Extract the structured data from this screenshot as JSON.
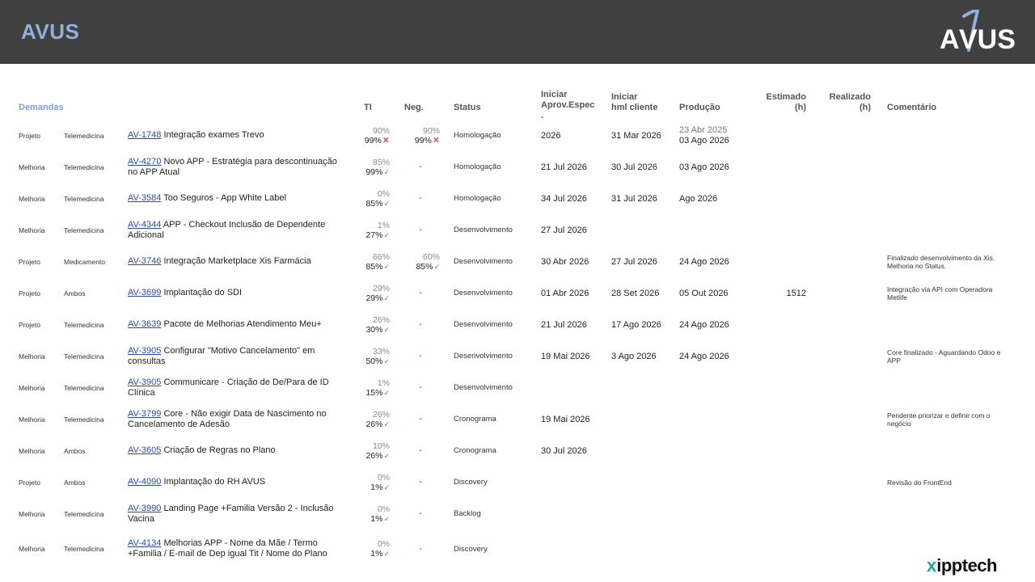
{
  "header": {
    "title": "AVUS",
    "logo_text": "AVUS"
  },
  "columns": {
    "demandas": "Demandas",
    "ti": "TI",
    "neg": "Neg.",
    "status": "Status",
    "aprov_1": "Iniciar",
    "aprov_2": "Aprov.Espec",
    "aprov_3": ".",
    "hml_1": "Iniciar",
    "hml_2": " hml cliente",
    "producao": "Produção",
    "estimado_1": "Estimado",
    "estimado_2": "(h)",
    "realizado_1": "Realizado",
    "realizado_2": "(h)",
    "comentario": "Comentário"
  },
  "rows": [
    {
      "tipo": "Projeto",
      "area": "Telemedicina",
      "code": "AV-1748",
      "title": " Integração exames Trevo",
      "ti_plan": "90%",
      "ti_real": "99%",
      "ti_mark": "✕",
      "neg_plan": "90%",
      "neg_real": "99%",
      "neg_mark": "✕",
      "status": "Homologação",
      "aprov": "2026",
      "hml": "31 Mar 2026",
      "prod_old": "23 Abr 2025",
      "prod": "03 Ago 2026",
      "estimado": "",
      "comentario": ""
    },
    {
      "tipo": "Melhoria",
      "area": "Telemedicina",
      "code": "AV-4270",
      "title": " Novo APP - Estratégia para descontinuação no APP Atual",
      "ti_plan": "85%",
      "ti_real": "99%",
      "ti_mark": "✓",
      "neg_dash": "-",
      "status": "Homologação",
      "aprov": "21 Jul  2026",
      "hml": "30 Jul 2026",
      "prod": "03 Ago 2026",
      "estimado": "",
      "comentario": ""
    },
    {
      "tipo": "Melhoria",
      "area": "Telemedicina",
      "code": "AV-3584",
      "title": " Too Seguros - App White Label",
      "ti_plan": "0%",
      "ti_real": "85%",
      "ti_mark": "✓",
      "neg_dash": "-",
      "status": "Homologação",
      "aprov": "34 Jul 2026",
      "hml": "31 Jul 2026",
      "prod": "Ago 2026",
      "estimado": "",
      "comentario": ""
    },
    {
      "tipo": "Melhoria",
      "area": "Telemedicina",
      "code": "AV-4344",
      "title": " APP - Checkout Inclusão de Dependente Adicional",
      "ti_plan": "1%",
      "ti_real": "27%",
      "ti_mark": "✓",
      "neg_dash": "-",
      "status": "Desenvolvimento",
      "aprov": "27 Jul  2026",
      "hml": "",
      "prod": "",
      "estimado": "",
      "comentario": ""
    },
    {
      "tipo": "Projeto",
      "area": "Medicamento",
      "code": "AV-3746",
      "title": " Integração Marketplace Xis Farmácia",
      "ti_plan": "66%",
      "ti_real": "85%",
      "ti_mark": "✓",
      "neg_plan": "60%",
      "neg_real": "85%",
      "neg_mark": "✓",
      "status": "Desenvolvimento",
      "aprov": "30 Abr 2026",
      "hml": "27 Jul 2026",
      "prod": "24 Ago 2026",
      "estimado": "",
      "comentario": "Finalizado desenvolvimento da Xis. Melhoria no Status."
    },
    {
      "tipo": "Projeto",
      "area": "Ambos",
      "code": "AV-3699",
      "title": " Implantação do SDI",
      "ti_plan": "29%",
      "ti_real": "29%",
      "ti_mark": "✓",
      "neg_dash": "-",
      "status": "Desenvolvimento",
      "aprov": "01 Abr 2026",
      "hml": "28 Set 2026",
      "prod": "05 Out 2026",
      "estimado": "1512",
      "comentario": "Integração via API com Operadora Metlife"
    },
    {
      "tipo": "Projeto",
      "area": "Telemedicina",
      "code": "AV-3639",
      "title": " Pacote de Melhorias Atendimento Meu+",
      "ti_plan": "26%",
      "ti_real": "30%",
      "ti_mark": "✓",
      "neg_dash": "-",
      "status": "Desenvolvimento",
      "aprov": "21 Jul  2026",
      "hml": "17 Ago 2026",
      "prod": "24 Ago 2026",
      "estimado": "",
      "comentario": ""
    },
    {
      "tipo": "Melhoria",
      "area": "Telemedicina",
      "code": "AV-3905",
      "title": " Configurar \"Motivo Cancelamento\" em consultas",
      "ti_plan": "33%",
      "ti_real": "50%",
      "ti_mark": "✓",
      "neg_dash": "-",
      "status": "Desenvolvimento",
      "aprov": "19 Mai 2026",
      "hml": "3 Ago 2026",
      "prod": "24 Ago 2026",
      "estimado": "",
      "comentario": "Core finalizado - Aguardando Odoo e APP"
    },
    {
      "tipo": "Melhoria",
      "area": "Telemedicina",
      "code": "AV-3905",
      "title": " Communicare - Criação de De/Para de ID Clínica",
      "ti_plan": "1%",
      "ti_real": "15%",
      "ti_mark": "✓",
      "neg_dash": "-",
      "status": "Desenvolvimento",
      "aprov": "",
      "hml": "",
      "prod": "",
      "estimado": "",
      "comentario": ""
    },
    {
      "tipo": "Melhoria",
      "area": "Telemedicina",
      "code": "AV-3799",
      "title": " Core - Não exigir Data de Nascimento no Cancelamento de Adesão",
      "ti_plan": "26%",
      "ti_real": "26%",
      "ti_mark": "✓",
      "neg_dash": "-",
      "status": "Cronograma",
      "aprov": "19 Mai 2026",
      "hml": "",
      "prod": "",
      "estimado": "",
      "comentario": "Pendente priorizar e definir com o negócio"
    },
    {
      "tipo": "Melhoria",
      "area": "Ambos",
      "code": "AV-3605",
      "title": " Criação de Regras no Plano",
      "ti_plan": "10%",
      "ti_real": "26%",
      "ti_mark": "✓",
      "neg_dash": "-",
      "status": "Cronograma",
      "aprov": "30 Jul 2026",
      "hml": "",
      "prod": "",
      "estimado": "",
      "comentario": ""
    },
    {
      "tipo": "Projeto",
      "area": "Ambos",
      "code": "AV-4090",
      "title": " Implantação do RH AVUS",
      "ti_plan": "0%",
      "ti_real": "1%",
      "ti_mark": "✓",
      "neg_dash": "-",
      "status": "Discovery",
      "aprov": "",
      "hml": "",
      "prod": "",
      "estimado": "",
      "comentario": "Revisão do FrontEnd"
    },
    {
      "tipo": "Melhoria",
      "area": "Telemedicina",
      "code": "AV-3990",
      "title": " Landing Page +Familia Versão 2 - Inclusão Vacina",
      "ti_plan": "0%",
      "ti_real": "1%",
      "ti_mark": "✓",
      "neg_dash": "-",
      "status": "Backlog",
      "aprov": "",
      "hml": "",
      "prod": "",
      "estimado": "",
      "comentario": ""
    },
    {
      "tipo": "Melhoria",
      "area": "Telemedicina",
      "code": "AV-4134",
      "title": " Melhorias APP - Nome da Mãe / Termo +Familia / E-mail de Dep igual Tit / Nome do Plano",
      "ti_plan": "0%",
      "ti_real": "1%",
      "ti_mark": "✓",
      "neg_dash": "-",
      "status": "Discovery",
      "aprov": "",
      "hml": "",
      "prod": "",
      "estimado": "",
      "comentario": ""
    }
  ],
  "footer": {
    "brand_x": "x",
    "brand_text": "ipptech"
  },
  "colors": {
    "header_bg": "#404040",
    "accent": "#8fb0dd",
    "link": "#2b4aa8",
    "ok": "#2eaa4a",
    "bad": "#d02a2a",
    "brand_teal": "#1aa7a0"
  }
}
